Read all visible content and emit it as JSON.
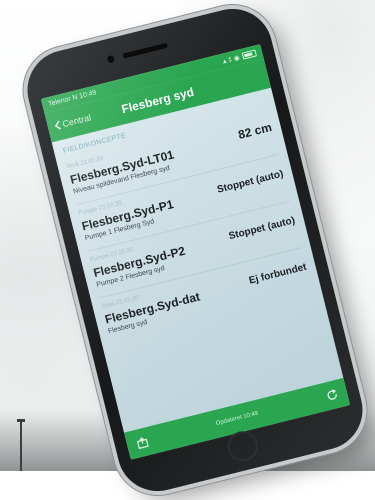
{
  "colors": {
    "accent": "#2aa650",
    "list_background": "#cfe0e5",
    "text_primary": "#1a1f22"
  },
  "status_bar": {
    "left": "Telenor N  10:49",
    "right": "▴ ‡ ◉"
  },
  "nav": {
    "back_label": "Central",
    "back_icon": "chevron-left-icon",
    "title": "Flesberg syd"
  },
  "section_header": "FIELD/KONCEPTE",
  "items": [
    {
      "meta": "Nivå 23.02.20",
      "name": "Flesberg.Syd-LT01",
      "desc": "Niveau spildevand Flesberg syd",
      "value": "82 cm",
      "stamp": ""
    },
    {
      "meta": "Pumpe 23.02.20",
      "name": "Flesberg.Syd-P1",
      "desc": "Pumpe 1 Flesberg Syd",
      "value": "Stoppet (auto)",
      "stamp": ""
    },
    {
      "meta": "Pumpe 23.02.20",
      "name": "Flesberg.Syd-P2",
      "desc": "Pumpe 2 Flesberg syd",
      "value": "Stoppet (auto)",
      "stamp": ""
    },
    {
      "meta": "Data 23.02.20",
      "name": "Flesberg.Syd-dat",
      "desc": "Flesberg syd",
      "value": "Ej forbundet",
      "stamp": ""
    }
  ],
  "bottom_bar": {
    "left_icon": "share-icon",
    "caption": "Opdateret 10:49",
    "right_icon": "refresh-icon"
  }
}
